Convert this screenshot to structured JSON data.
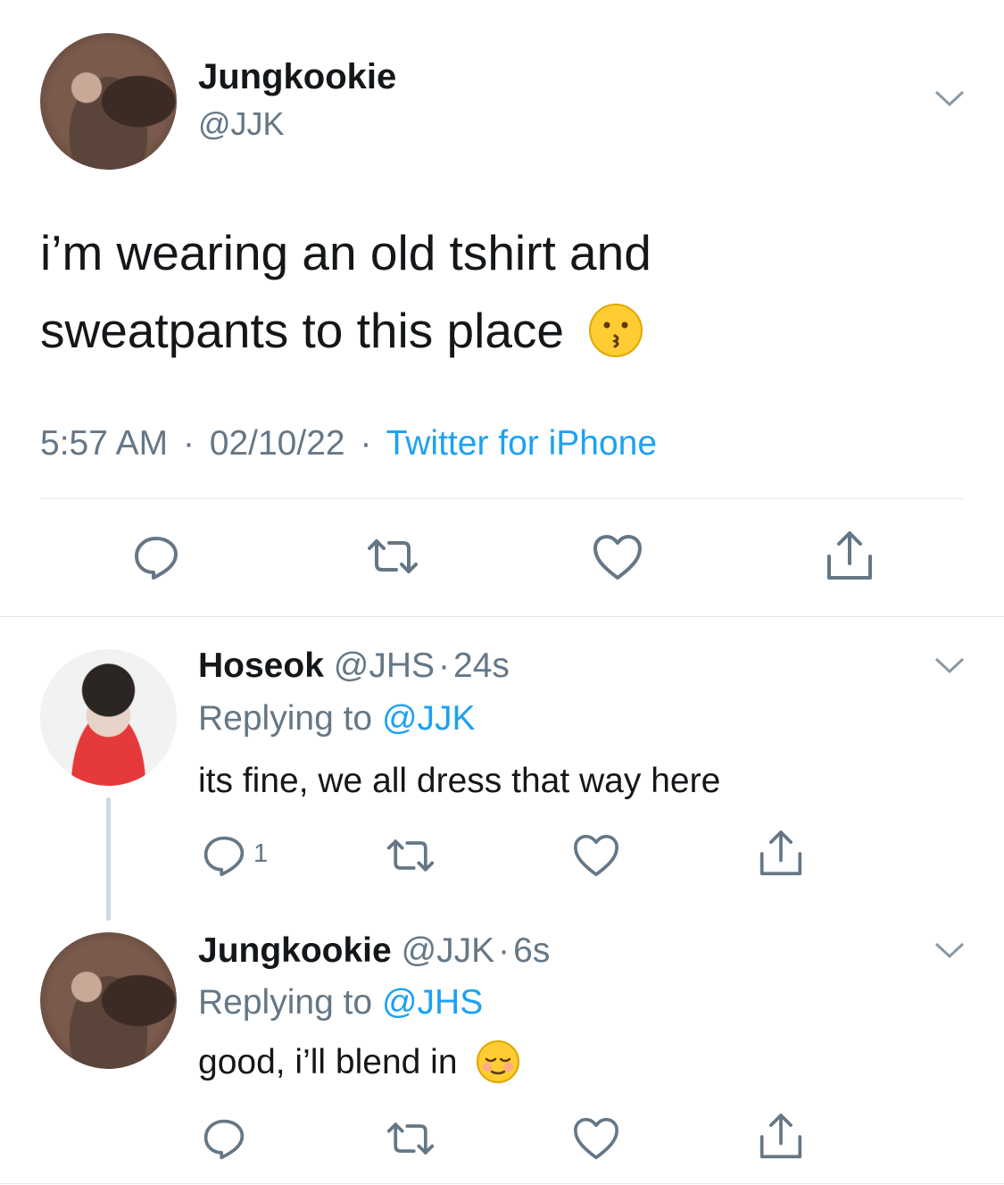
{
  "main_tweet": {
    "name": "Jungkookie",
    "handle": "@JJK",
    "text_line1": "i’m wearing an old tshirt and",
    "text_line2": "sweatpants to this place",
    "time": "5:57 AM",
    "sep1": "·",
    "date": "02/10/22",
    "sep2": "·",
    "source": "Twitter for iPhone"
  },
  "reply1": {
    "name": "Hoseok",
    "handle": "@JHS",
    "sep": "·",
    "age": "24s",
    "replying_prefix": "Replying to",
    "replying_to": "@JJK",
    "text": "its fine, we all dress that way here",
    "reply_count": "1"
  },
  "reply2": {
    "name": "Jungkookie",
    "handle": "@JJK",
    "sep": "·",
    "age": "6s",
    "replying_prefix": "Replying to",
    "replying_to": "@JHS",
    "text": "good, i’ll blend in"
  },
  "icons": {
    "reply": "reply-icon",
    "retweet": "retweet-icon",
    "like": "like-icon",
    "share": "share-icon",
    "more": "chevron-down-icon"
  },
  "colors": {
    "link": "#1da1f2",
    "muted": "#657786",
    "icon": "#657786",
    "divider": "#e1e8ed"
  }
}
